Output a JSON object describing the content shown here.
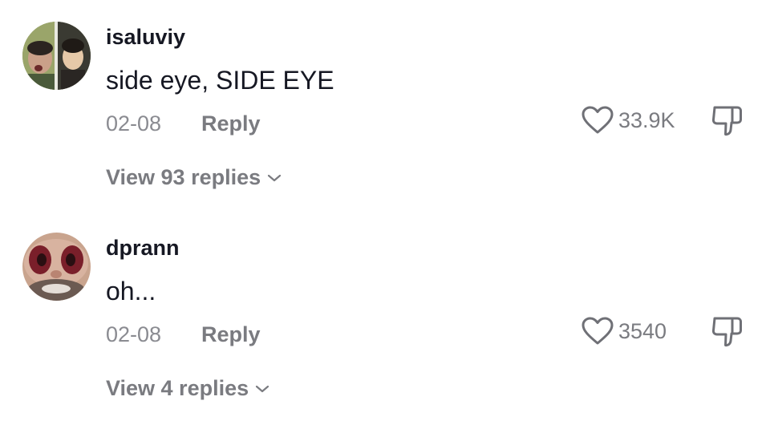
{
  "comments": [
    {
      "username": "isaluviy",
      "text": "side eye, SIDE EYE",
      "date": "02-08",
      "reply_label": "Reply",
      "likes": "33.9K",
      "view_replies": "View 93 replies",
      "avatar_icon": "user-avatar-photo"
    },
    {
      "username": "dprann",
      "text": "oh...",
      "date": "02-08",
      "reply_label": "Reply",
      "likes": "3540",
      "view_replies": "View 4 replies",
      "avatar_icon": "user-avatar-photo"
    }
  ],
  "icons": {
    "like": "heart-outline-icon",
    "dislike": "thumbs-down-outline-icon",
    "expand": "chevron-down-icon"
  },
  "colors": {
    "primary_text": "#161823",
    "secondary_text": "#8a8b91",
    "action_text": "#7a7b80",
    "background": "#ffffff"
  }
}
